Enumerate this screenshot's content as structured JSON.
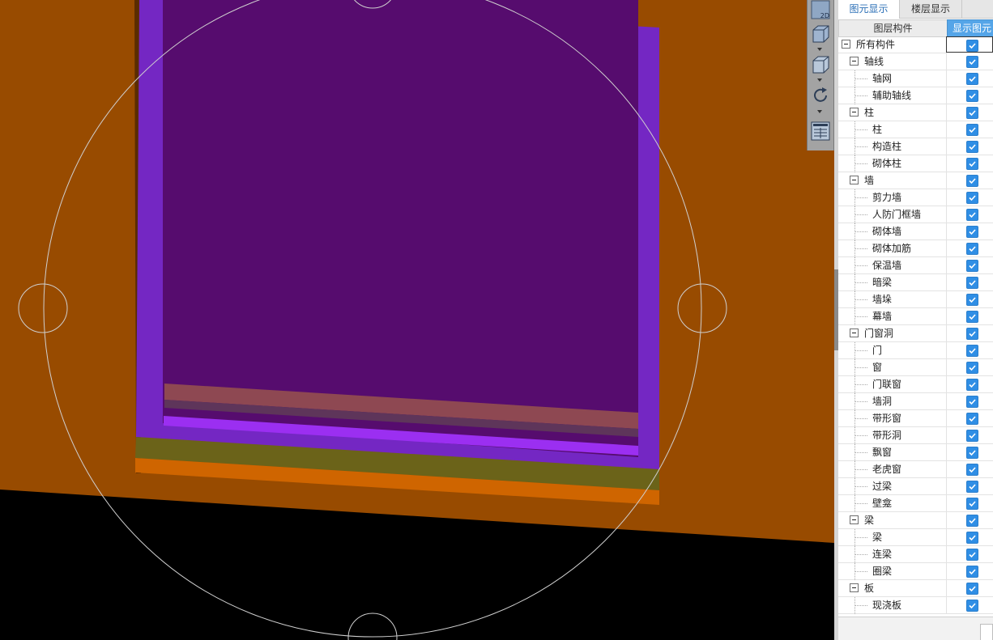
{
  "tabs": [
    {
      "label": "图元显示",
      "active": true
    },
    {
      "label": "楼层显示",
      "active": false
    }
  ],
  "grid_header": {
    "name_column": "图层构件",
    "show_column": "显示图元"
  },
  "toolbar": {
    "view_2d_label": "2D"
  },
  "tree": [
    {
      "label": "所有构件",
      "level": 0,
      "expander": true,
      "checked": false
    },
    {
      "label": "轴线",
      "level": 1,
      "expander": true,
      "checked": true
    },
    {
      "label": "轴网",
      "level": 2,
      "checked": true
    },
    {
      "label": "辅助轴线",
      "level": 2,
      "checked": true
    },
    {
      "label": "柱",
      "level": 1,
      "expander": true,
      "checked": true
    },
    {
      "label": "柱",
      "level": 2,
      "checked": true
    },
    {
      "label": "构造柱",
      "level": 2,
      "checked": true
    },
    {
      "label": "砌体柱",
      "level": 2,
      "checked": true
    },
    {
      "label": "墙",
      "level": 1,
      "expander": true,
      "checked": true
    },
    {
      "label": "剪力墙",
      "level": 2,
      "checked": true
    },
    {
      "label": "人防门框墙",
      "level": 2,
      "checked": true
    },
    {
      "label": "砌体墙",
      "level": 2,
      "checked": true
    },
    {
      "label": "砌体加筋",
      "level": 2,
      "checked": true
    },
    {
      "label": "保温墙",
      "level": 2,
      "checked": true
    },
    {
      "label": "暗梁",
      "level": 2,
      "checked": true
    },
    {
      "label": "墙垛",
      "level": 2,
      "checked": true
    },
    {
      "label": "幕墙",
      "level": 2,
      "checked": true
    },
    {
      "label": "门窗洞",
      "level": 1,
      "expander": true,
      "checked": true
    },
    {
      "label": "门",
      "level": 2,
      "checked": true
    },
    {
      "label": "窗",
      "level": 2,
      "checked": true
    },
    {
      "label": "门联窗",
      "level": 2,
      "checked": true
    },
    {
      "label": "墙洞",
      "level": 2,
      "checked": true
    },
    {
      "label": "带形窗",
      "level": 2,
      "checked": true
    },
    {
      "label": "带形洞",
      "level": 2,
      "checked": true
    },
    {
      "label": "飘窗",
      "level": 2,
      "checked": true
    },
    {
      "label": "老虎窗",
      "level": 2,
      "checked": true
    },
    {
      "label": "过梁",
      "level": 2,
      "checked": true
    },
    {
      "label": "壁龛",
      "level": 2,
      "checked": true
    },
    {
      "label": "梁",
      "level": 1,
      "expander": true,
      "checked": true
    },
    {
      "label": "梁",
      "level": 2,
      "checked": true
    },
    {
      "label": "连梁",
      "level": 2,
      "checked": true
    },
    {
      "label": "圈梁",
      "level": 2,
      "checked": true
    },
    {
      "label": "板",
      "level": 1,
      "expander": true,
      "checked": true
    },
    {
      "label": "现浇板",
      "level": 2,
      "checked": true
    }
  ],
  "colors": {
    "slab": "#984b00",
    "wall_purple": "#7427c3",
    "inner_purple": "#560c6e",
    "olive_band": "#6b6319",
    "orange_band": "#cf6500",
    "checkbox_blue": "#2f8ee5",
    "header_blue": "#55a5e8"
  }
}
